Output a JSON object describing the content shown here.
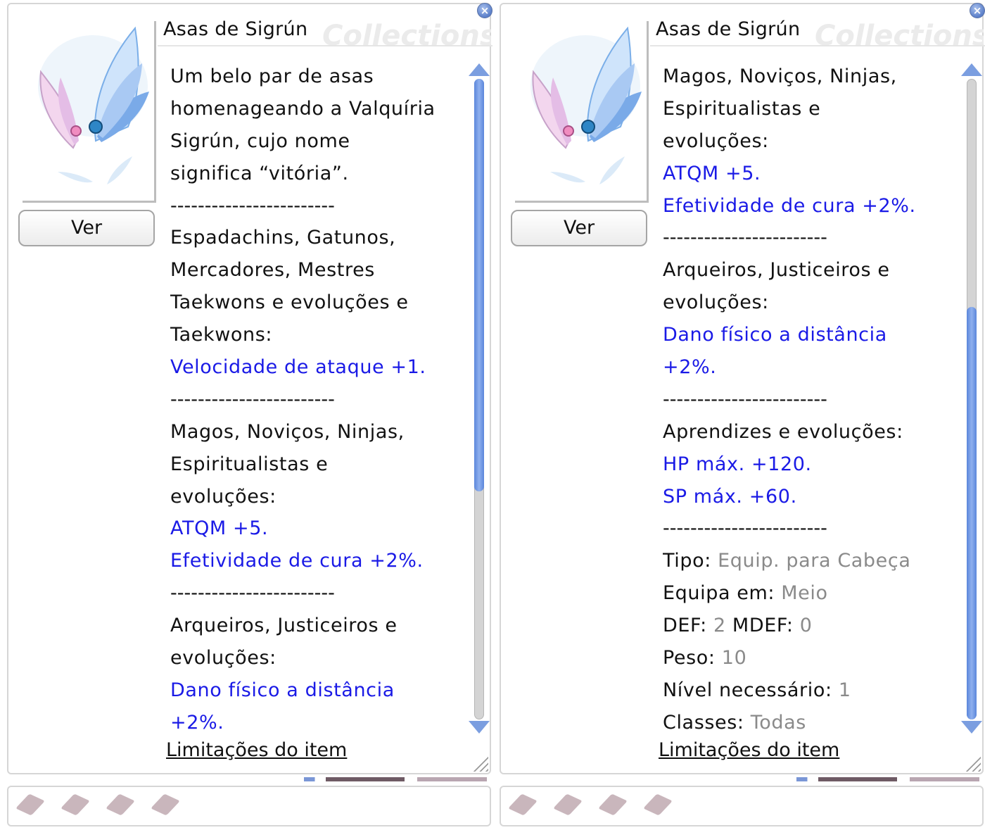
{
  "windows": [
    {
      "id": "left",
      "title": "Asas de Sigrún",
      "watermark": "Collections",
      "view_button": "Ver",
      "close_icon": "close-icon",
      "lines": [
        {
          "t": "Um belo par de asas",
          "s": "normal"
        },
        {
          "t": "homenageando a Valquíria",
          "s": "normal"
        },
        {
          "t": "Sigrún, cujo nome",
          "s": "normal"
        },
        {
          "t": "significa “vitória”.",
          "s": "normal"
        },
        {
          "t": "------------------------",
          "s": "sep"
        },
        {
          "t": "Espadachins, Gatunos,",
          "s": "normal"
        },
        {
          "t": "Mercadores, Mestres",
          "s": "normal"
        },
        {
          "t": "Taekwons e evoluções e",
          "s": "normal"
        },
        {
          "t": "Taekwons:",
          "s": "normal"
        },
        {
          "t": "Velocidade de ataque +1.",
          "s": "blue"
        },
        {
          "t": "------------------------",
          "s": "sep"
        },
        {
          "t": "Magos, Noviços, Ninjas,",
          "s": "normal"
        },
        {
          "t": "Espiritualistas e",
          "s": "normal"
        },
        {
          "t": "evoluções:",
          "s": "normal"
        },
        {
          "t": "ATQM +5.",
          "s": "blue"
        },
        {
          "t": "Efetividade de cura +2%.",
          "s": "blue"
        },
        {
          "t": "------------------------",
          "s": "sep"
        },
        {
          "t": "Arqueiros, Justiceiros e",
          "s": "normal"
        },
        {
          "t": "evoluções:",
          "s": "normal"
        },
        {
          "t": "Dano físico a distância",
          "s": "blue"
        },
        {
          "t": "+2%.",
          "s": "blue"
        }
      ],
      "limits_link": "Limitações do item",
      "scroll_position": 0.0
    },
    {
      "id": "right",
      "title": "Asas de Sigrún",
      "watermark": "Collections",
      "view_button": "Ver",
      "close_icon": "close-icon",
      "lines": [
        {
          "t": "Magos, Noviços, Ninjas,",
          "s": "normal"
        },
        {
          "t": "Espiritualistas e",
          "s": "normal"
        },
        {
          "t": "evoluções:",
          "s": "normal"
        },
        {
          "t": "ATQM +5.",
          "s": "blue"
        },
        {
          "t": "Efetividade de cura +2%.",
          "s": "blue"
        },
        {
          "t": "------------------------",
          "s": "sep"
        },
        {
          "t": "Arqueiros, Justiceiros e",
          "s": "normal"
        },
        {
          "t": "evoluções:",
          "s": "normal"
        },
        {
          "t": "Dano físico a distância",
          "s": "blue"
        },
        {
          "t": "+2%.",
          "s": "blue"
        },
        {
          "t": "------------------------",
          "s": "sep"
        },
        {
          "t": "Aprendizes e evoluções:",
          "s": "normal"
        },
        {
          "t": "HP máx. +120.",
          "s": "blue"
        },
        {
          "t": "SP máx. +60.",
          "s": "blue"
        },
        {
          "t": "------------------------",
          "s": "sep"
        },
        {
          "k": "Tipo: ",
          "v": "Equip. para Cabeça",
          "s": "kv"
        },
        {
          "k": "Equipa em: ",
          "v": "Meio",
          "s": "kv"
        },
        {
          "k": "DEF: ",
          "v": "2",
          "k2": " MDEF: ",
          "v2": "0",
          "s": "kv2"
        },
        {
          "k": "Peso: ",
          "v": "10",
          "s": "kv"
        },
        {
          "k": "Nível necessário: ",
          "v": "1",
          "s": "kv"
        },
        {
          "k": "Classes: ",
          "v": "Todas",
          "s": "kv"
        }
      ],
      "limits_link": "Limitações do item",
      "scroll_position": 1.0
    }
  ],
  "colors": {
    "effect_text": "#1a1ae6",
    "value_text": "#8a8a8a",
    "scroll_thumb": "#5b86db"
  },
  "card_slots": 4
}
